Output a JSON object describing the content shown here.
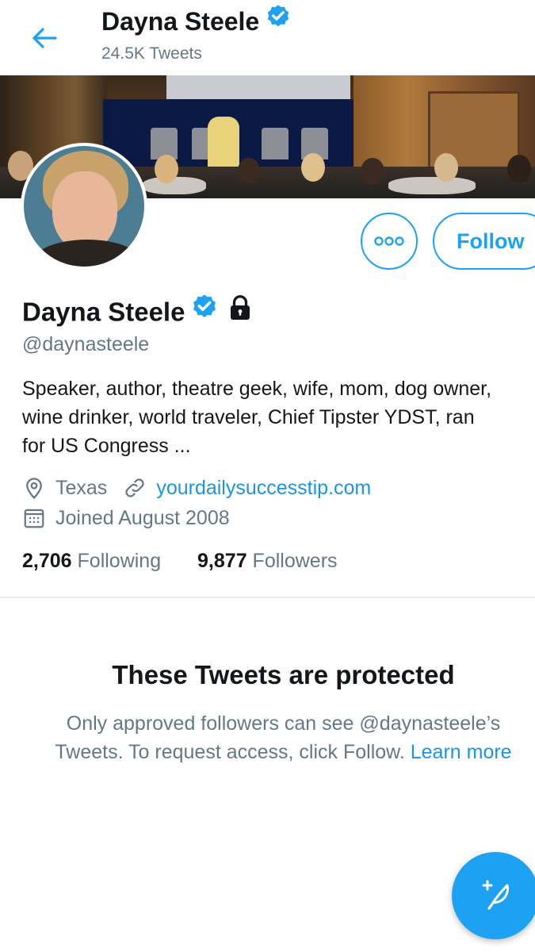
{
  "header": {
    "back_icon": "arrow-left-icon",
    "name": "Dayna Steele",
    "tweet_count": "24.5K Tweets"
  },
  "profile": {
    "name": "Dayna Steele",
    "handle": "@daynasteele",
    "verified": true,
    "protected": true,
    "bio_lines": [
      "Speaker, author, theatre geek, wife, mom, dog owner,",
      "wine drinker, world traveler, Chief Tipster YDST, ran",
      "for US Congress ..."
    ],
    "location": "Texas",
    "website": "yourdailysuccesstip.com",
    "joined": "Joined August 2008",
    "following_count": "2,706",
    "following_label": "Following",
    "followers_count": "9,877",
    "followers_label": "Followers"
  },
  "actions": {
    "more_icon": "more-dots-icon",
    "follow_label": "Follow"
  },
  "protected_notice": {
    "title": "These Tweets are protected",
    "line1": "Only approved followers can see @daynasteele’s",
    "line2": "Tweets. To request access, click Follow.",
    "learn_more": "Learn more"
  },
  "fab": {
    "icon": "compose-tweet-icon"
  },
  "colors": {
    "accent": "#1da1f2",
    "secondary_text": "#657786",
    "primary_text": "#14171a"
  }
}
